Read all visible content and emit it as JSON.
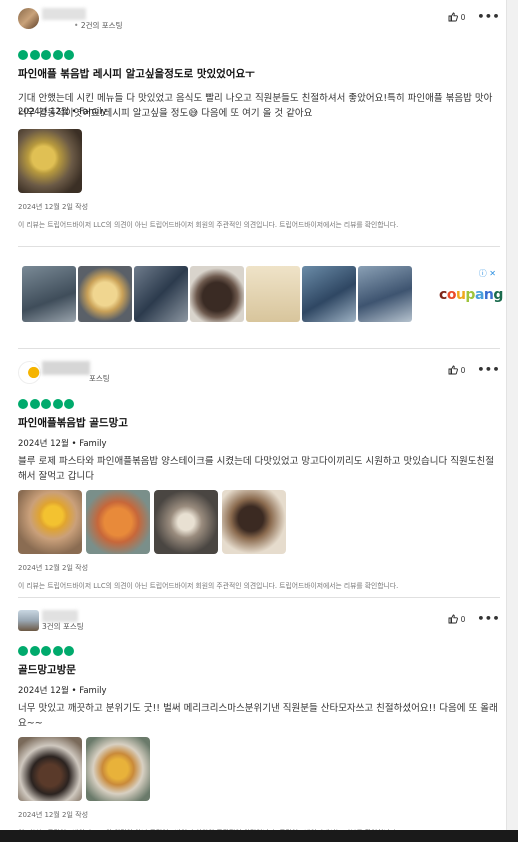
{
  "reviews": [
    {
      "author_meta": "2건의 포스팅",
      "author_meta_prefix": "•",
      "likes": "0",
      "title": "파인애플 볶음밥 레시피 알고싶을정도로 맛있었어요ㅜ",
      "date": "2024년 12월",
      "trip_type": "Family",
      "body": "기대 안했는데 시킨 메뉴들 다 맛있었고 음식도 빨리 나오고 직원분들도 친절하셔서 좋았어요!특히 파인애플 볶음밥 맛아 너무 감동적이엿어요!레시피 알고싶을 정도😅 다음에 또 여기 올 것 같아요",
      "written": "2024년 12월 2일 작성",
      "disclaimer": "이 리뷰는 트립어드바이저 LLC의 의견이 아닌 트립어드바이저 회원의 주관적인 의견입니다. 트립어드바이저에서는 리뷰를 확인합니다."
    },
    {
      "author_meta": "포스팅",
      "likes": "0",
      "title": "파인애플볶음밥 골드망고",
      "date": "2024년 12월",
      "trip_type": "Family",
      "body": "블루 로제 파스타와 파인애플볶음밥 양스테이크를 시켰는데 다맛있었고 망고다이끼리도 시원하고 맛있습니다 직원도친절해서 잘먹고 갑니다",
      "written": "2024년 12월 2일 작성",
      "disclaimer": "이 리뷰는 트립어드바이저 LLC의 의견이 아닌 트립어드바이저 회원의 주관적인 의견입니다. 트립어드바이저에서는 리뷰를 확인합니다."
    },
    {
      "author_meta": "3건의 포스팅",
      "likes": "0",
      "title": "골드망고방문",
      "date": "2024년 12월",
      "trip_type": "Family",
      "body": "너무 맛있고 깨끗하고 분위기도 굿!! 벌써 메리크리스마스분위기낸 직원분들 산타모자쓰고 친절하셨어요!! 다음에 또 올래요~~",
      "written": "2024년 12월 2일 작성",
      "disclaimer": "이 리뷰는 트립어드바이저 LLC의 의견이 아닌 트립어드바이저 회원의 주관적인 의견입니다. 트립어드바이저에서는 리뷰를 확인합니다."
    }
  ],
  "separator": "•",
  "ad": {
    "brand": "coupang"
  },
  "colors": {
    "bubble": "#00aa6c",
    "divider": "#e0e0e0"
  },
  "icons": {
    "like": "thumbs-up-icon",
    "more": "more-horizontal-icon",
    "adchoices": "adchoices-icon"
  }
}
